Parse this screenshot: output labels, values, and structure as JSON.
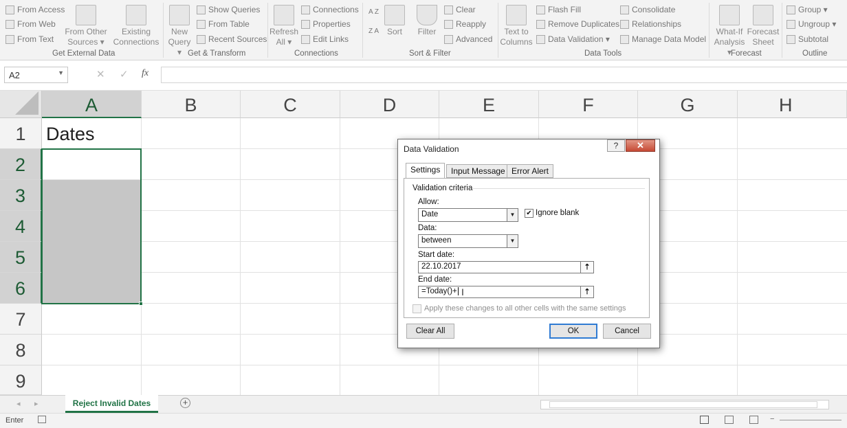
{
  "ribbon": {
    "get_external": {
      "from_access": "From Access",
      "from_web": "From Web",
      "from_text": "From Text",
      "from_other": "From Other Sources ▾",
      "existing": "Existing Connections",
      "group": "Get External Data"
    },
    "get_transform": {
      "new_query": "New Query ▾",
      "show_queries": "Show Queries",
      "from_table": "From Table",
      "recent_sources": "Recent Sources",
      "group": "Get & Transform"
    },
    "connections": {
      "refresh_all": "Refresh All ▾",
      "connections": "Connections",
      "properties": "Properties",
      "edit_links": "Edit Links",
      "group": "Connections"
    },
    "sort_filter": {
      "sort_az": "A Z",
      "sort_za": "Z A",
      "sort": "Sort",
      "filter": "Filter",
      "clear": "Clear",
      "reapply": "Reapply",
      "advanced": "Advanced",
      "group": "Sort & Filter"
    },
    "data_tools": {
      "text_to_columns": "Text to Columns",
      "flash_fill": "Flash Fill",
      "remove_duplicates": "Remove Duplicates",
      "data_validation": "Data Validation ▾",
      "consolidate": "Consolidate",
      "relationships": "Relationships",
      "manage_model": "Manage Data Model",
      "group": "Data Tools"
    },
    "forecast": {
      "what_if": "What-If Analysis ▾",
      "forecast_sheet": "Forecast Sheet",
      "group": "Forecast"
    },
    "outline": {
      "group_btn": "Group ▾",
      "ungroup": "Ungroup ▾",
      "subtotal": "Subtotal",
      "group": "Outline"
    }
  },
  "formula_bar": {
    "name_box": "A2",
    "cancel": "✕",
    "enter": "✓",
    "fx": "fx",
    "value": ""
  },
  "columns": [
    "A",
    "B",
    "C",
    "D",
    "E",
    "F",
    "G",
    "H"
  ],
  "rows": [
    "1",
    "2",
    "3",
    "4",
    "5",
    "6",
    "7",
    "8",
    "9"
  ],
  "cells": {
    "A1": "Dates"
  },
  "sheet_tabs": {
    "active": "Reject Invalid Dates",
    "add": "+"
  },
  "status_bar": {
    "mode": "Enter"
  },
  "dialog": {
    "title": "Data Validation",
    "help": "?",
    "close": "✕",
    "tabs": [
      "Settings",
      "Input Message",
      "Error Alert"
    ],
    "section": "Validation criteria",
    "allow_label": "Allow:",
    "allow_value": "Date",
    "ignore_blank": "Ignore blank",
    "ignore_blank_checked": true,
    "data_label": "Data:",
    "data_value": "between",
    "start_label": "Start date:",
    "start_value": "22.10.2017",
    "end_label": "End date:",
    "end_value": "=Today()+",
    "apply_all": "Apply these changes to all other cells with the same settings",
    "clear_all": "Clear All",
    "ok": "OK",
    "cancel": "Cancel"
  }
}
